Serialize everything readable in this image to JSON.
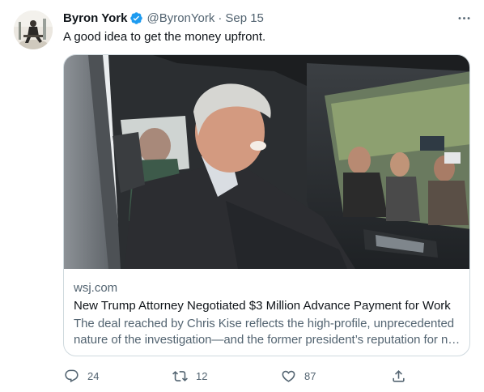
{
  "author": {
    "display_name": "Byron York",
    "handle": "@ByronYork",
    "separator": "·",
    "date": "Sep 15",
    "verified": true
  },
  "tweet": {
    "text": "A good idea to get the money upfront."
  },
  "card": {
    "domain": "wsj.com",
    "title": "New Trump Attorney Negotiated $3 Million Advance Payment for Work",
    "description": "The deal reached by Chris Kise reflects the high-profile, unprecedented nature of the investigation—and the former president’s reputation for not paying his lawyers."
  },
  "actions": {
    "reply_count": "24",
    "retweet_count": "12",
    "like_count": "87"
  },
  "icons": {
    "verified": "verified-badge-icon",
    "more": "more-options-icon",
    "reply": "reply-icon",
    "retweet": "retweet-icon",
    "like": "heart-icon",
    "share": "share-icon"
  },
  "colors": {
    "accent": "#1d9bf0",
    "text_primary": "#0f1419",
    "text_secondary": "#536471",
    "border": "#cfd9de"
  }
}
